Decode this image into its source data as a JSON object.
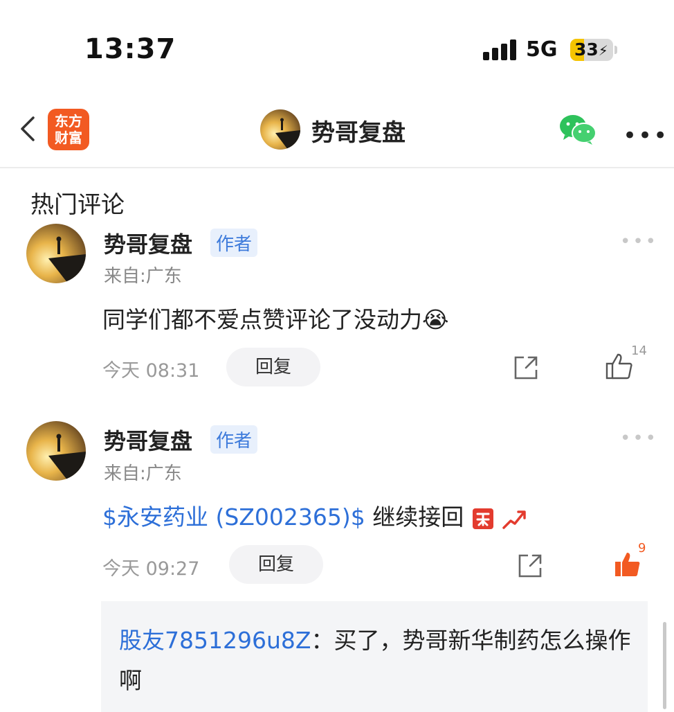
{
  "status_bar": {
    "time": "13:37",
    "network": "5G",
    "battery": "33"
  },
  "header": {
    "logo_line1": "东方",
    "logo_line2": "财富",
    "title": "势哥复盘"
  },
  "section": {
    "title": "热门评论"
  },
  "comments": [
    {
      "name": "势哥复盘",
      "tag": "作者",
      "location": "来自:广东",
      "text": "同学们都不爱点赞评论了没动力",
      "emoji": "😭",
      "time": "今天 08:31",
      "reply_label": "回复",
      "likes": "14"
    },
    {
      "name": "势哥复盘",
      "tag": "作者",
      "location": "来自:广东",
      "stock_link": "$永安药业 (SZ002365)$",
      "text": " 继续接回",
      "time": "今天 09:27",
      "reply_label": "回复",
      "likes": "9",
      "reply": {
        "user": "股友7851296u8Z",
        "separator": "：",
        "text": "买了，势哥新华制药怎么操作啊"
      }
    }
  ],
  "colors": {
    "accent_blue": "#2d6fd8",
    "brand_orange": "#f25a22",
    "liked_orange": "#f25a22"
  }
}
